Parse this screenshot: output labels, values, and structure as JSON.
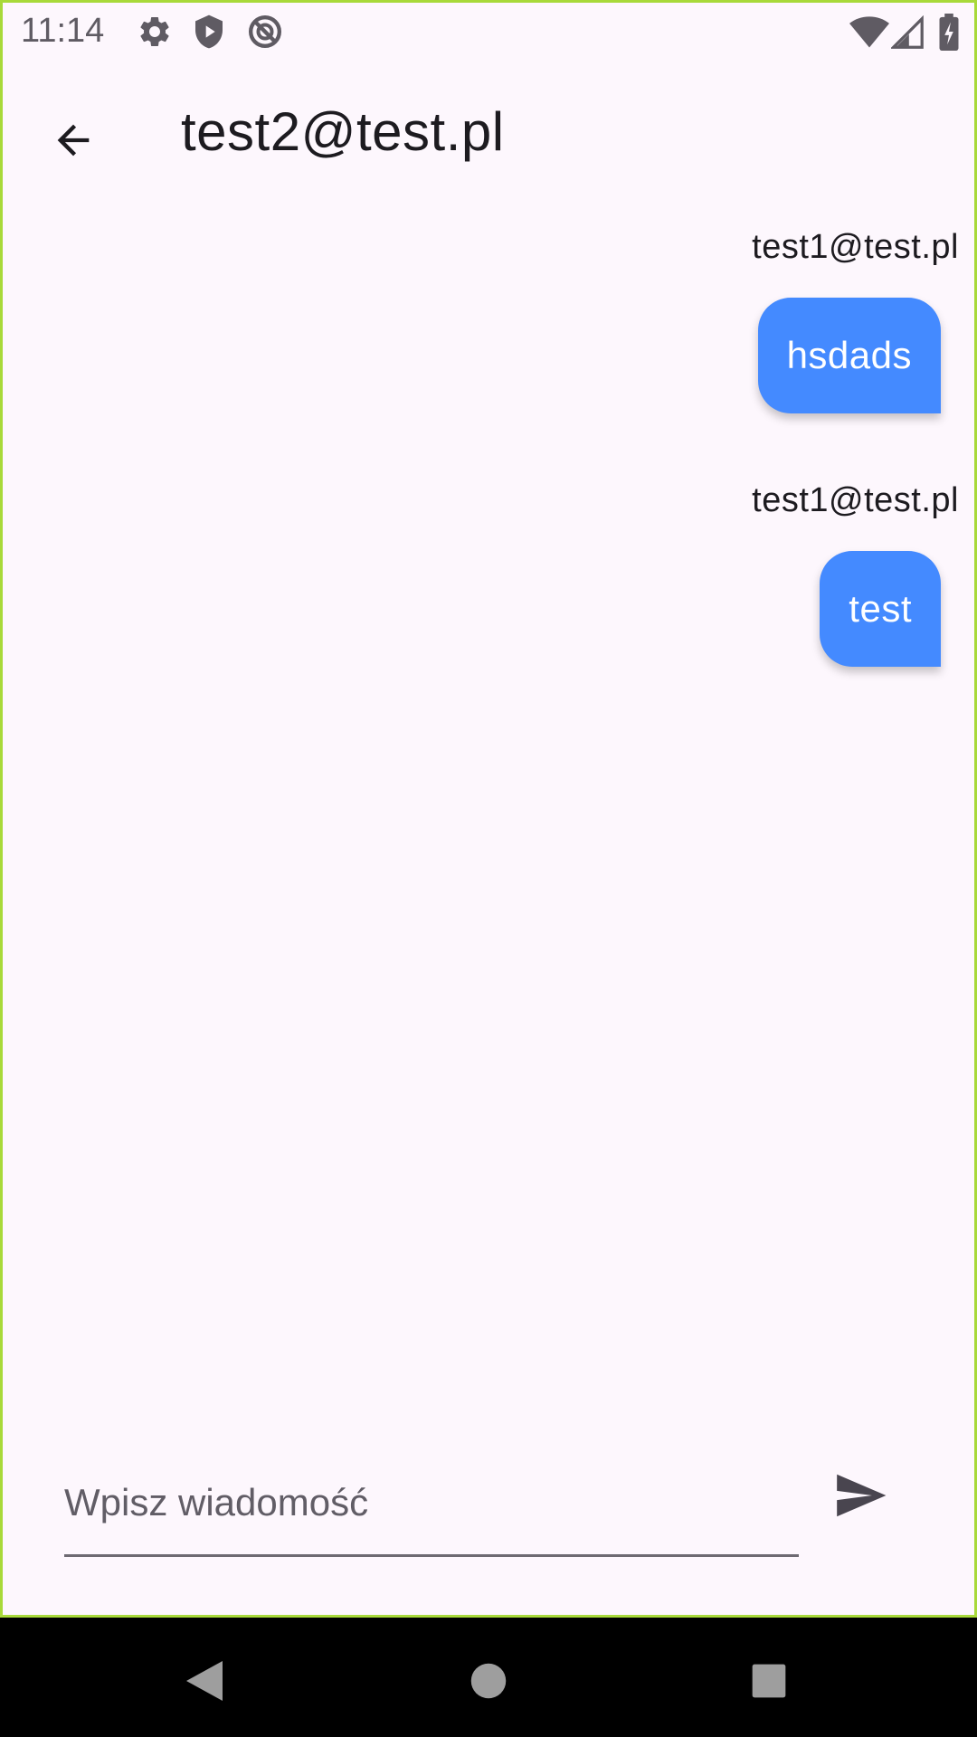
{
  "status_bar": {
    "time": "11:14",
    "left_icons": [
      "gear-icon",
      "shield-play-icon",
      "do-not-disturb-icon"
    ],
    "right_icons": [
      "wifi-icon",
      "cellular-signal-icon",
      "battery-charging-icon"
    ]
  },
  "app_bar": {
    "title": "test2@test.pl",
    "back_icon": "arrow-back-icon"
  },
  "messages": [
    {
      "sender": "test1@test.pl",
      "text": "hsdads"
    },
    {
      "sender": "test1@test.pl",
      "text": "test"
    }
  ],
  "composer": {
    "placeholder": "Wpisz wiadomość",
    "value": "",
    "send_icon": "send-icon"
  },
  "nav_bar": {
    "buttons": [
      "back-triangle-icon",
      "home-circle-icon",
      "recents-square-icon"
    ]
  },
  "colors": {
    "background": "#fdf7fd",
    "bubble": "#448aff",
    "bubble_text": "#ffffff",
    "frame_border": "#a8d93a"
  }
}
